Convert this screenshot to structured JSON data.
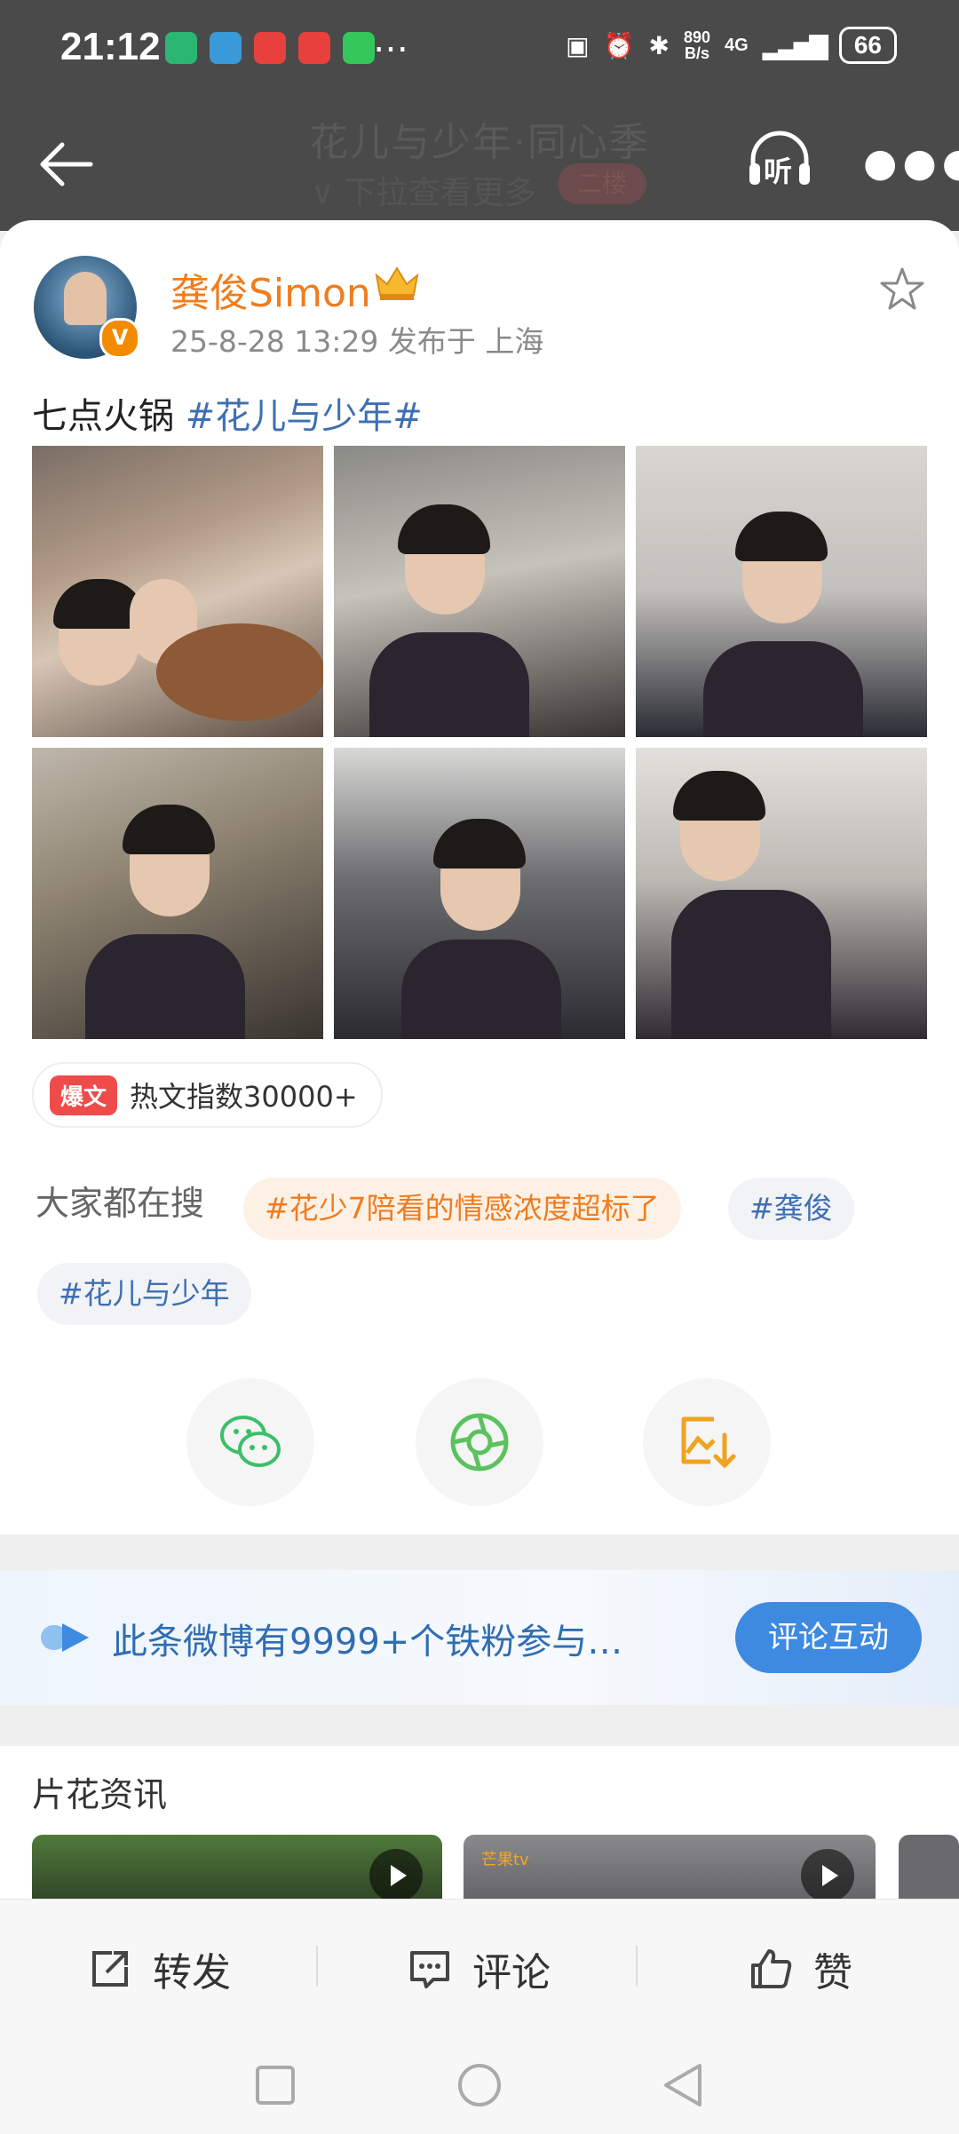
{
  "status_bar": {
    "time": "21:12",
    "overflow": "…",
    "net_speed_value": "890",
    "net_speed_unit": "B/s",
    "signal": "4G",
    "battery": "66",
    "app_icon_colors": [
      "#2bb673",
      "#3a9ad9",
      "#e8403d",
      "#e8403d",
      "#34c759"
    ]
  },
  "nav": {
    "ghost_title": "花儿与少年·同心季",
    "ghost_subtitle": "∨ 下拉查看更多",
    "ghost_badge": "二楼",
    "listen_label": "听"
  },
  "post": {
    "author": "龚俊Simon",
    "verified_mark": "V",
    "meta": "25-8-28 13:29  发布于 上海",
    "text": "七点火锅 ",
    "hashtag": "#花儿与少年#",
    "hot_badge": "爆文",
    "hot_text": "热文指数30000+"
  },
  "search": {
    "label": "大家都在搜",
    "chips": [
      "#花少7陪看的情感浓度超标了",
      "#龚俊",
      "#花儿与少年"
    ]
  },
  "share": {
    "icons": [
      "wechat-icon",
      "moments-icon",
      "save-image-icon"
    ]
  },
  "banner": {
    "text": "此条微博有9999+个铁粉参与…",
    "button": "评论互动"
  },
  "section": {
    "title": "片花资讯",
    "video2_badge": "芒果tv"
  },
  "actions": {
    "repost": "转发",
    "comment": "评论",
    "like": "赞"
  }
}
